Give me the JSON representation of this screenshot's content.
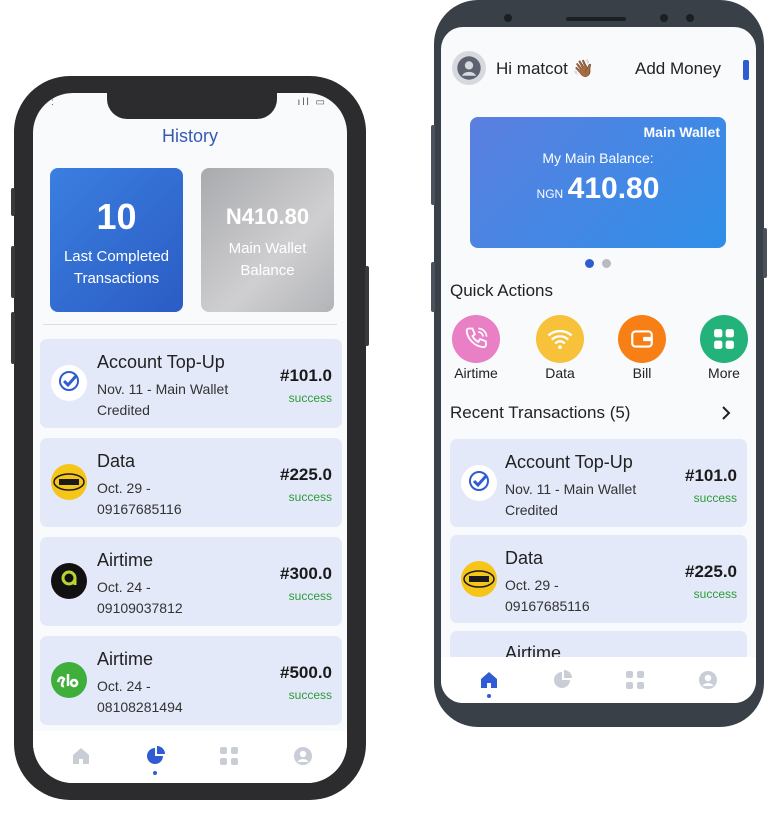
{
  "left": {
    "title": "History",
    "stats": [
      {
        "value": "10",
        "caption": "Last Completed Transactions"
      },
      {
        "value": "N410.80",
        "caption": "Main Wallet Balance"
      }
    ],
    "transactions": [
      {
        "title": "Account Top-Up",
        "date": "Nov. 11  - Main Wallet Credited",
        "amount": "#101.0",
        "status": "success",
        "logo": "vosty-logo"
      },
      {
        "title": "Data",
        "date": "Oct. 29  - 09167685116",
        "amount": "#225.0",
        "status": "success",
        "logo": "mtn-logo"
      },
      {
        "title": "Airtime",
        "date": "Oct. 24  - 09109037812",
        "amount": "#300.0",
        "status": "success",
        "logo": "9mobile-logo"
      },
      {
        "title": "Airtime",
        "date": "Oct. 24  - 08108281494",
        "amount": "#500.0",
        "status": "success",
        "logo": "glo-logo"
      }
    ],
    "nav": [
      "home-icon",
      "chart-icon",
      "grid-icon",
      "profile-icon"
    ],
    "active_nav": "chart-icon"
  },
  "right": {
    "greeting": "Hi matcot 👋🏾",
    "add_money": "Add Money",
    "wallet": {
      "label": "Main Wallet",
      "balance_label": "My Main Balance:",
      "currency": "NGN",
      "balance": "410.80"
    },
    "quick_actions_title": "Quick Actions",
    "quick_actions": [
      {
        "label": "Airtime",
        "color": "#e97fc4",
        "icon": "phone-icon"
      },
      {
        "label": "Data",
        "color": "#f7c23a",
        "icon": "wifi-icon"
      },
      {
        "label": "Bill",
        "color": "#f77f16",
        "icon": "wallet-icon"
      },
      {
        "label": "More",
        "color": "#23b37a",
        "icon": "grid-icon"
      }
    ],
    "recent_title": "Recent Transactions (5)",
    "transactions": [
      {
        "title": "Account Top-Up",
        "date": "Nov. 11  - Main Wallet Credited",
        "amount": "#101.0",
        "status": "success",
        "logo": "vosty-logo"
      },
      {
        "title": "Data",
        "date": "Oct. 29  - 09167685116",
        "amount": "#225.0",
        "status": "success",
        "logo": "mtn-logo"
      },
      {
        "title": "Airtime"
      }
    ],
    "nav": [
      "home-icon",
      "chart-icon",
      "grid-icon",
      "profile-icon"
    ],
    "active_nav": "home-icon"
  },
  "colors": {
    "accent": "#2f5cd2",
    "success": "#2e9b3a",
    "card_bg": "#e3e9f8"
  }
}
